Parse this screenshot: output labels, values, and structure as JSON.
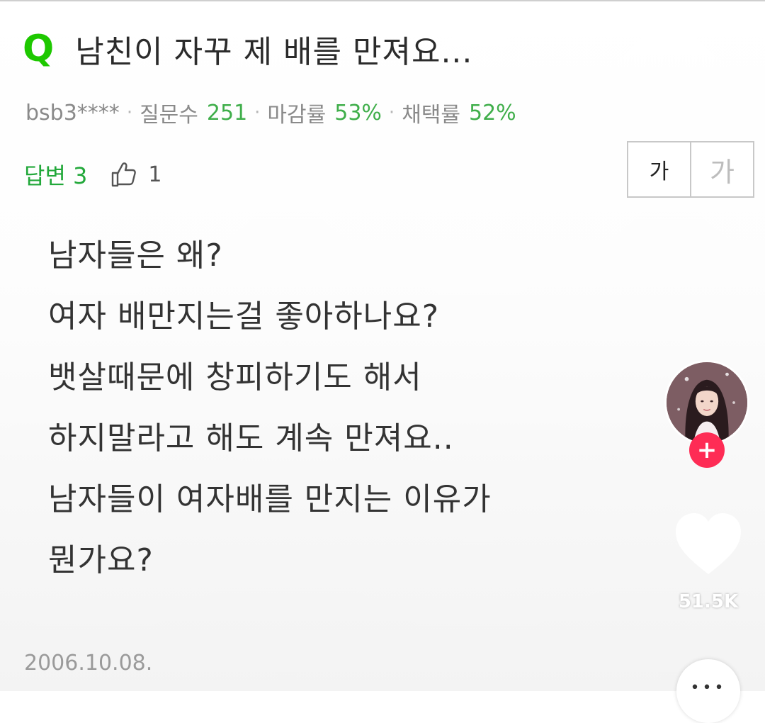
{
  "question": {
    "mark": "Q",
    "title": "남친이 자꾸 제 배를 만져요..."
  },
  "meta": {
    "user": "bsb3****",
    "separator": "·",
    "questions_label": "질문수",
    "questions_value": "251",
    "close_rate_label": "마감률",
    "close_rate_value": "53%",
    "adopt_rate_label": "채택률",
    "adopt_rate_value": "52%"
  },
  "answer": {
    "label": "답변 3",
    "likes": "1"
  },
  "font_toggle": {
    "small": "가",
    "large": "가"
  },
  "body": {
    "lines": [
      "남자들은 왜?",
      "여자 배만지는걸 좋아하나요?",
      "뱃살때문에 창피하기도 해서",
      "하지말라고 해도 계속 만져요..",
      "남자들이 여자배를 만지는 이유가",
      "뭔가요?"
    ]
  },
  "date": "2006.10.08.",
  "overlay": {
    "follow": "+",
    "like_total": "51.5K",
    "more": "•••"
  },
  "colors": {
    "naver_green": "#1ec800",
    "stat_green": "#3fae4a",
    "tiktok_red": "#fe2c55"
  }
}
